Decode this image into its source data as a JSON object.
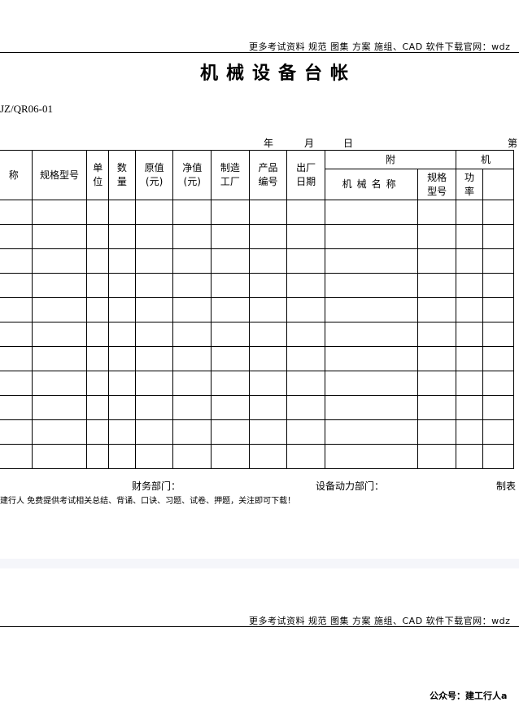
{
  "header_banner": "更多考试资料 规范 图集 方案 施组、CAD 软件下载官网：wdz",
  "title": "机械设备台帐",
  "doc_code": "JZ/QR06-01",
  "date": {
    "year": "年",
    "month": "月",
    "day": "日",
    "page": "第"
  },
  "columns": {
    "name": "称",
    "spec_model": "规格型号",
    "unit": [
      "单",
      "位"
    ],
    "quantity": [
      "数",
      "量"
    ],
    "original_value": [
      "原值",
      "(元)"
    ],
    "net_value": [
      "净值",
      "(元)"
    ],
    "manufacturer": [
      "制造",
      "工厂"
    ],
    "product_no": [
      "产品",
      "编号"
    ],
    "factory_date": [
      "出厂",
      "日期"
    ],
    "attached_group": "附",
    "attached_machine_group": "机",
    "machine_name": "机械名称",
    "attached_spec": [
      "规格",
      "型号"
    ],
    "power": [
      "功",
      "率"
    ]
  },
  "row_count": 11,
  "footer": {
    "finance_dept": "财务部门：",
    "equipment_dept": "设备动力部门：",
    "preparer": "制表"
  },
  "promo_text": "建行人 免费提供考试相关总结、背诵、口诀、习题、试卷、押题，关注即可下载！",
  "watermark": "公众号：建工行人a"
}
